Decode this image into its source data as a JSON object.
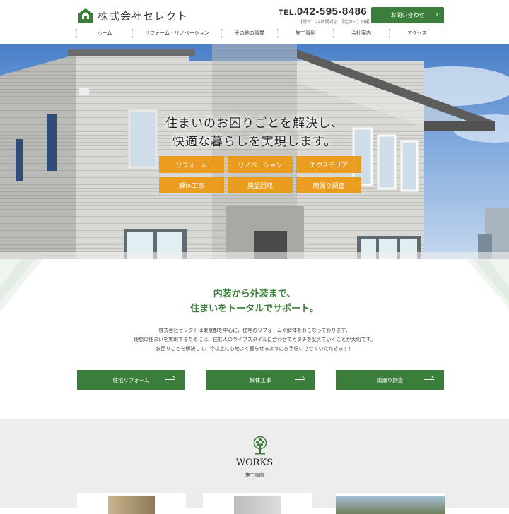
{
  "header": {
    "company_name": "株式会社セレクト",
    "tel_label": "TEL.",
    "tel_number": "042-595-8486",
    "hours": "【受付】24時間対応　【定休日】日曜",
    "contact_button": "お問い合わせ",
    "nav": [
      "ホーム",
      "リフォーム・リノベーション",
      "その他の事業",
      "施工事例",
      "会社案内",
      "アクセス"
    ]
  },
  "hero": {
    "headline_line1": "住まいのお困りごとを解決し、",
    "headline_line2": "快適な暮らしを実現します。",
    "categories": [
      "リフォーム",
      "リノベーション",
      "エクステリア",
      "解体工事",
      "廃品回収",
      "雨漏り調査"
    ]
  },
  "intro": {
    "title_line1": "内装から外装まで、",
    "title_line2": "住まいをトータルでサポート。",
    "body_line1": "株式会社セレクトは東京都を中心に、住宅のリフォームや解体をおこなっております。",
    "body_line2": "理想の住まいを実現するためには、住む人のライフスタイルに合わせてカタチを変えていくことが大切です。",
    "body_line3": "お困りごとを解決して、今以上に心地よく暮らせるようにお手伝いさせていただきます！",
    "services": [
      "住宅リフォーム",
      "解体工事",
      "雨漏り調査"
    ]
  },
  "works": {
    "title": "WORKS",
    "subtitle": "施工事例"
  },
  "colors": {
    "brand_green": "#3b7d3a",
    "accent_orange": "#ec9810",
    "sky_blue": "#5b8fd6"
  },
  "icons": [
    "house-logo-icon",
    "arrow-right-icon",
    "tree-icon"
  ]
}
